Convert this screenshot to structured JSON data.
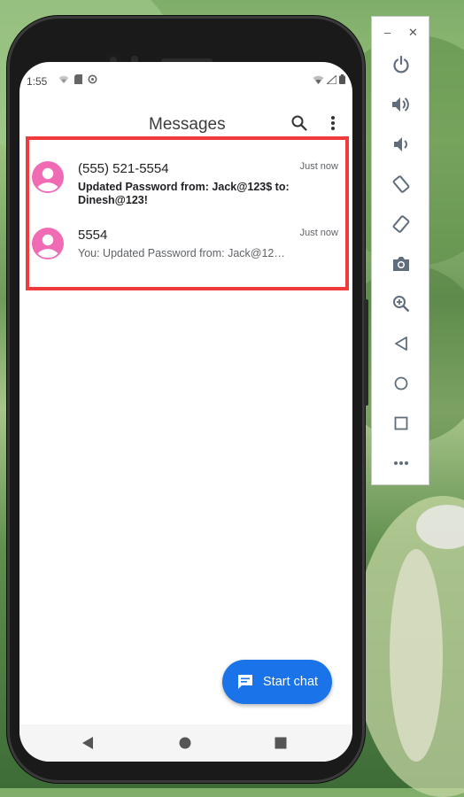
{
  "status_bar": {
    "time": "1:55"
  },
  "app_bar": {
    "title": "Messages"
  },
  "conversations": [
    {
      "name": "(555) 521-5554",
      "time": "Just now",
      "snippet": "Updated Password from: Jack@123$ to: Dinesh@123!",
      "unread": true
    },
    {
      "name": "5554",
      "time": "Just now",
      "snippet": "You: Updated Password from: Jack@12…",
      "unread": false
    }
  ],
  "fab": {
    "label": "Start chat"
  },
  "colors": {
    "accent": "#1a73e8",
    "avatar": "#f06bb4",
    "highlight": "#ef3b3b"
  },
  "emulator_toolbar": {
    "buttons": [
      "power-icon",
      "volume-up-icon",
      "volume-down-icon",
      "rotate-left-icon",
      "rotate-right-icon",
      "camera-icon",
      "zoom-icon",
      "back-icon",
      "home-icon",
      "overview-icon",
      "more-icon"
    ]
  }
}
